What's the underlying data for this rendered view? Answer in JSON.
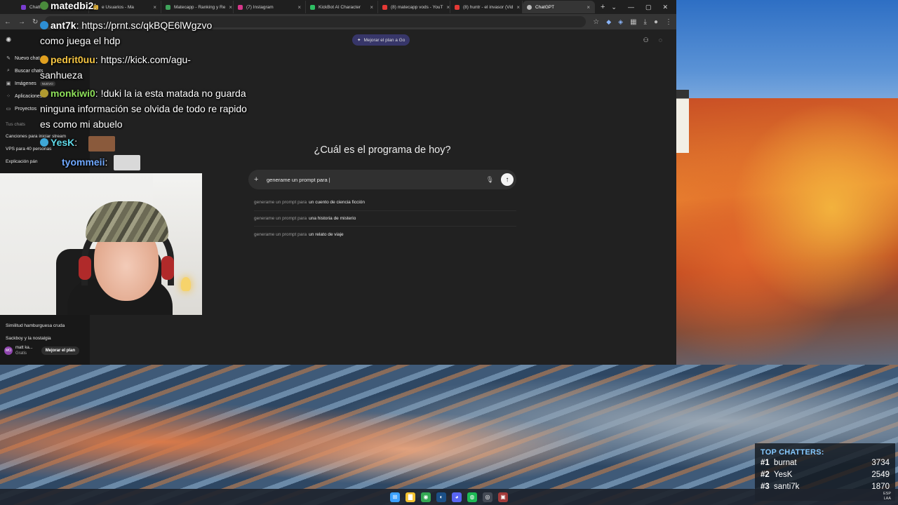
{
  "browser": {
    "tabs": [
      {
        "label": "Chatter",
        "color": "#7a3dd1",
        "active": false
      },
      {
        "label": "e Usuarios - Ma",
        "color": "#e2b33c",
        "active": false
      },
      {
        "label": "Matecapp - Ranking y Re",
        "color": "#3fa35b",
        "active": false
      },
      {
        "label": "(7) Instagram",
        "color": "#d6378a",
        "active": false
      },
      {
        "label": "KickBot AI Character",
        "color": "#2ebf63",
        "active": false
      },
      {
        "label": "(8) matecapp vods - YouT",
        "color": "#e53935",
        "active": false
      },
      {
        "label": "(8) huntr - el invasor (Vid",
        "color": "#e53935",
        "active": false
      },
      {
        "label": "ChatGPT",
        "color": "#bbbbbb",
        "active": true
      }
    ],
    "new_tab": "+",
    "window_controls": [
      "⌄",
      "—",
      "▢",
      "✕"
    ]
  },
  "chatgpt": {
    "sidebar": {
      "items": [
        {
          "label": "Nuevo chat",
          "icon": "✎"
        },
        {
          "label": "Buscar chats",
          "icon": "⌕"
        },
        {
          "label": "Imágenes",
          "icon": "▣",
          "badge": "NUEVO"
        },
        {
          "label": "Aplicaciones",
          "icon": "⁘"
        },
        {
          "label": "Proyectos",
          "icon": "▭"
        }
      ],
      "section_title": "Tus chats",
      "chats": [
        "Canciones para iniciar stream",
        "VPS para 40 personas",
        "Explicación pán",
        "Similitud hamburguesa cruda",
        "Sackboy y la nostalgia"
      ],
      "user": {
        "initials": "MO",
        "name": "matt ka...",
        "plan": "Gratis",
        "upgrade": "Mejorar el plan"
      }
    },
    "upgrade_pill": "Mejorar el plan a Go",
    "headline": "¿Cuál es el programa de hoy?",
    "composer": {
      "value": "generame un prompt para |"
    },
    "suggestions": [
      {
        "prefix": "generame un prompt para",
        "rest": "un cuento de ciencia ficción"
      },
      {
        "prefix": "generame un prompt para",
        "rest": "una historia de misterio"
      },
      {
        "prefix": "generame un prompt para",
        "rest": "un relato de viaje"
      }
    ]
  },
  "stream_chat": [
    {
      "name": "matedbi2",
      "name_color": "#ffffff",
      "text": ""
    },
    {
      "name": "ant7k",
      "name_color": "#ffffff",
      "text": "https://prnt.sc/qkBQE6lWgzvo"
    },
    {
      "name": "",
      "name_color": "#ffffff",
      "text": "como juega el hdp"
    },
    {
      "name": "pedrit0uu",
      "name_color": "#f5c542",
      "text": "https://kick.com/agu-"
    },
    {
      "name": "",
      "name_color": "#ffffff",
      "text": "sanhueza"
    },
    {
      "name": "monkiwi0",
      "name_color": "#8ee05a",
      "text": "!duki la ia esta matada no guarda"
    },
    {
      "name": "",
      "name_color": "#ffffff",
      "text": "ninguna información se olvida de todo re rapido"
    },
    {
      "name": "",
      "name_color": "#ffffff",
      "text": "es como mi abuelo"
    },
    {
      "name": "YesK",
      "name_color": "#5fd9e8",
      "text": ""
    },
    {
      "name": "tyommeii",
      "name_color": "#6fa8ff",
      "text": ""
    }
  ],
  "top_chatters": {
    "title": "TOP CHATTERS:",
    "rows": [
      {
        "rank": "#1",
        "name": "burnat",
        "count": "3734"
      },
      {
        "rank": "#2",
        "name": "YesK",
        "count": "2549"
      },
      {
        "rank": "#3",
        "name": "santi7k",
        "count": "1870"
      }
    ]
  },
  "taskbar": {
    "icons": [
      {
        "name": "windows-start-icon",
        "glyph": "⊞",
        "color": "#3aa0ff"
      },
      {
        "name": "file-explorer-icon",
        "glyph": "▇",
        "color": "#f2c230"
      },
      {
        "name": "chrome-icon",
        "glyph": "◉",
        "color": "#34a853"
      },
      {
        "name": "steam-icon",
        "glyph": "◐",
        "color": "#1b4f86"
      },
      {
        "name": "discord-icon",
        "glyph": "◕",
        "color": "#5865f2"
      },
      {
        "name": "spotify-icon",
        "glyph": "◍",
        "color": "#1db954"
      },
      {
        "name": "obs-icon",
        "glyph": "◎",
        "color": "#444a55"
      },
      {
        "name": "streaming-app-icon",
        "glyph": "▣",
        "color": "#a33a3a"
      }
    ],
    "tray": [
      "ESP",
      "LAA"
    ]
  }
}
